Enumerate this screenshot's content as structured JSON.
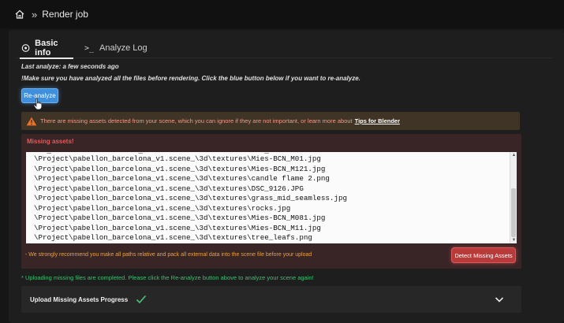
{
  "breadcrumb": {
    "current": "Render job",
    "separator": "»"
  },
  "tabs": [
    {
      "label": "Basic info",
      "icon": "target-icon",
      "active": true
    },
    {
      "label": "Analyze Log",
      "icon": "terminal-icon",
      "active": false
    }
  ],
  "info": {
    "last_analyze": "Last analyze: a few seconds ago",
    "note": "!Make sure you have analyzed all the files before rendering. Click the blue button below if you want to re-analyze."
  },
  "reanalyze_button": "Re-analyze",
  "warning": {
    "text": "There are missing assets detected from your scene, which you can ignore if they are not important, or learn more about",
    "link": "Tips for Blender"
  },
  "missing_assets": {
    "title": "Missing assets!",
    "files": [
      "\\Project\\pabellon_barcelona_v1.scene_\\3d\\textures\\Mies-BCN_M01.jpg",
      "\\Project\\pabellon_barcelona_v1.scene_\\3d\\textures\\Mies-BCN_M121.jpg",
      "\\Project\\pabellon_barcelona_v1.scene_\\3d\\textures\\candle flame 2.png",
      "\\Project\\pabellon_barcelona_v1.scene_\\3d\\textures\\DSC_9126.JPG",
      "\\Project\\pabellon_barcelona_v1.scene_\\3d\\textures\\grass_mid_seamless.jpg",
      "\\Project\\pabellon_barcelona_v1.scene_\\3d\\textures\\rocks.jpg",
      "\\Project\\pabellon_barcelona_v1.scene_\\3d\\textures\\Mies-BCN_M081.jpg",
      "\\Project\\pabellon_barcelona_v1.scene_\\3d\\textures\\Mies-BCN_M11.jpg",
      "\\Project\\pabellon_barcelona_v1.scene_\\3d\\textures\\tree_leafs.png"
    ],
    "recommend": "- We strongly recommend you make all paths relative and pack all external data into the scene file before your upload",
    "detect_button": "Detect Missing Assets"
  },
  "upload_note": "* Uploading missing files are completed. Please click the Re-analyze button above to analyze your scene again!",
  "progress_panel": {
    "label": "Upload Missing Assets Progress",
    "status_icon": "check-icon"
  },
  "colors": {
    "accent_blue": "#3f8fdc",
    "danger_red": "#b93a3a",
    "success_green": "#3fbf6f",
    "warning_orange": "#e8a23c"
  }
}
